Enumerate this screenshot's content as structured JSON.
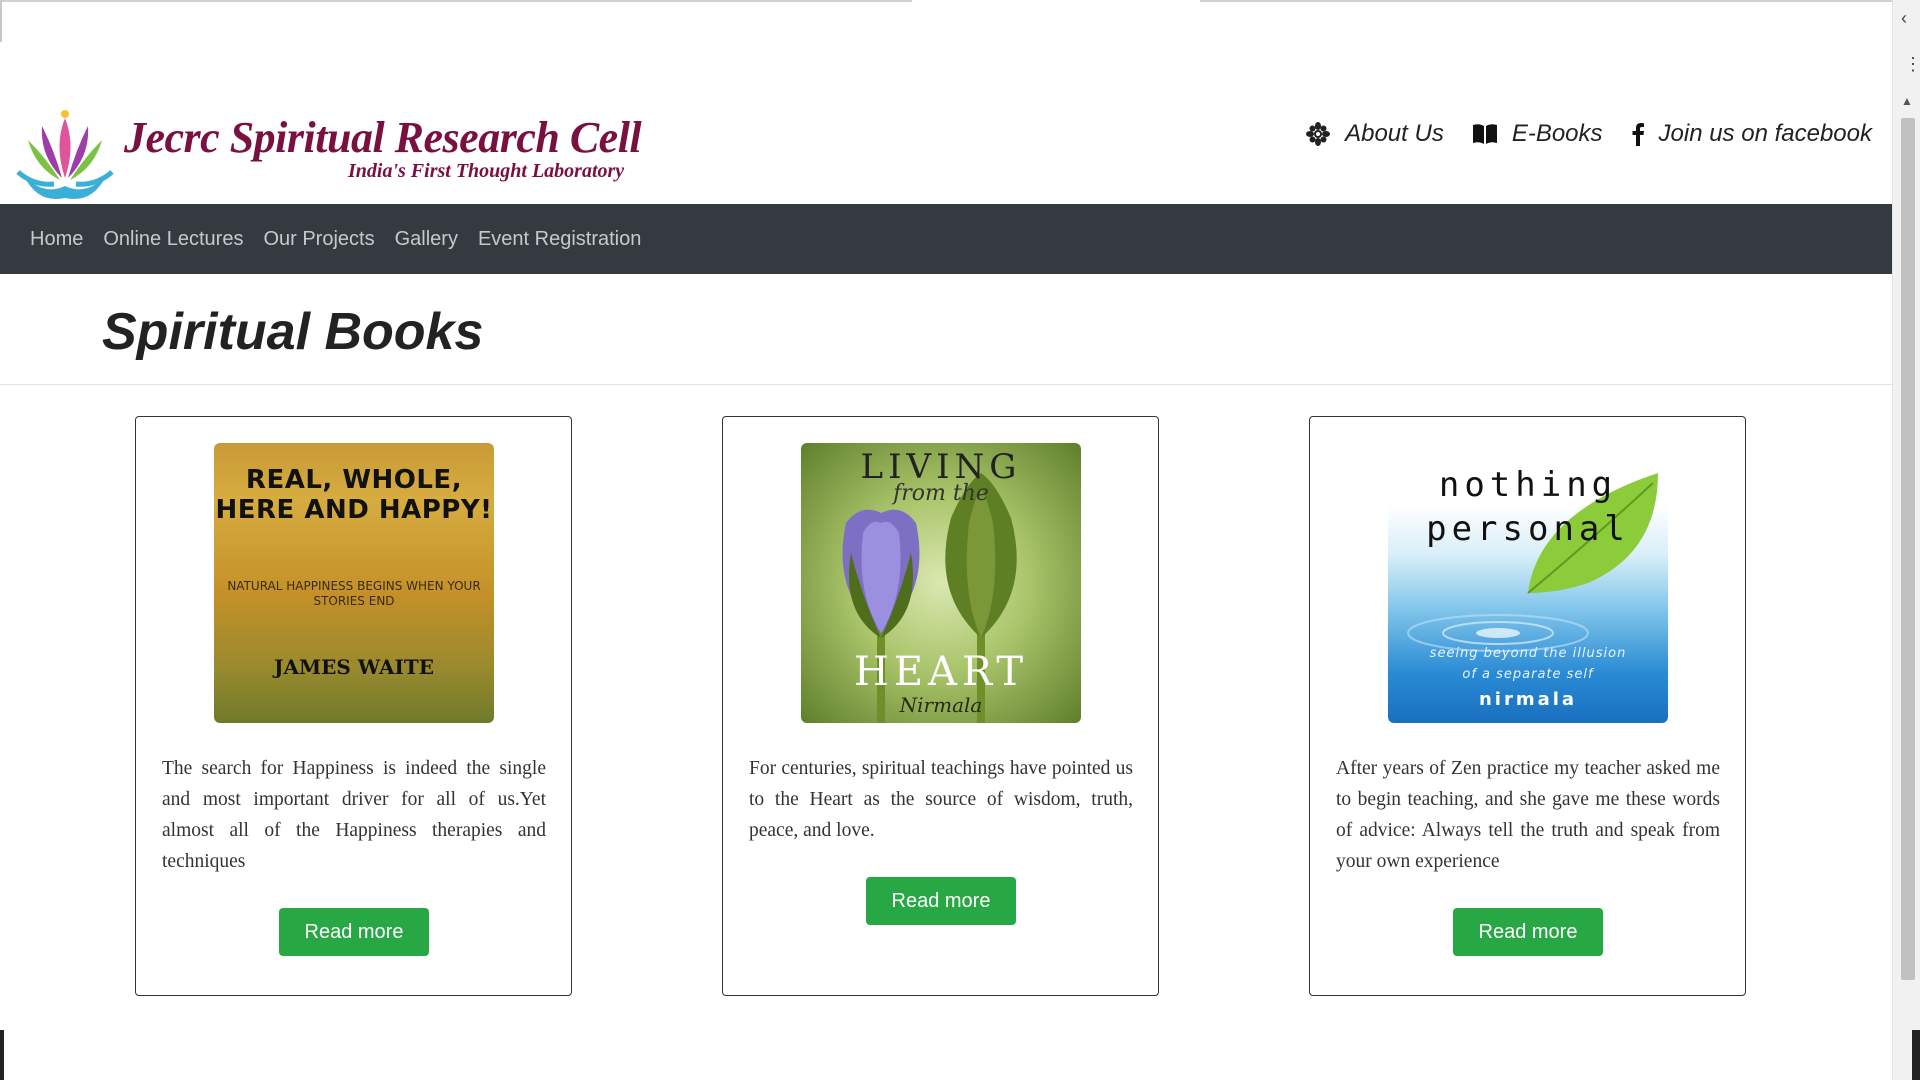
{
  "brand": {
    "title": "Jecrc Spiritual Research Cell",
    "subtitle": "India's First Thought Laboratory"
  },
  "top_links": [
    {
      "label": "About Us",
      "icon": "lotus-flower-icon"
    },
    {
      "label": "E-Books",
      "icon": "open-book-icon"
    },
    {
      "label": "Join us on facebook",
      "icon": "facebook-icon"
    }
  ],
  "nav": {
    "items": [
      {
        "label": "Home"
      },
      {
        "label": "Online Lectures"
      },
      {
        "label": "Our Projects"
      },
      {
        "label": "Gallery"
      },
      {
        "label": "Event Registration"
      }
    ]
  },
  "page": {
    "heading": "Spiritual Books"
  },
  "books": [
    {
      "cover": {
        "title": "REAL, WHOLE, HERE AND HAPPY!",
        "subtitle": "NATURAL HAPPINESS BEGINS WHEN YOUR STORIES END",
        "author": "JAMES WAITE"
      },
      "description": "The search for Happiness is indeed the single and most important driver for all of us.Yet almost all of the Happiness therapies and techniques",
      "button": "Read more"
    },
    {
      "cover": {
        "title_top": "LIVING",
        "title_mid": "from the",
        "title_bottom": "HEART",
        "author": "Nirmala"
      },
      "description": "For centuries, spiritual teachings have pointed us to the Heart as the source of wisdom, truth, peace, and love.",
      "button": "Read more"
    },
    {
      "cover": {
        "title_line1": "nothing",
        "title_line2": "personal",
        "subtitle_line1": "seeing beyond the illusion",
        "subtitle_line2": "of a separate self",
        "author": "nirmala"
      },
      "description": "After years of Zen practice my teacher asked me to begin teaching, and she gave me these words of advice: Always tell the truth and speak from your own experience",
      "button": "Read more"
    }
  ],
  "colors": {
    "brand": "#7a1040",
    "navbar_bg": "#343a40",
    "button_bg": "#28a745"
  }
}
